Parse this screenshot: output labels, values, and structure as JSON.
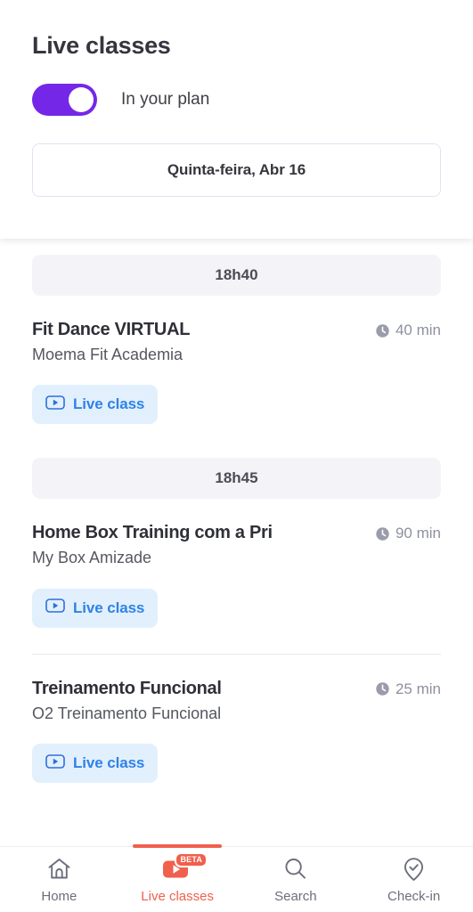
{
  "header": {
    "title": "Live classes",
    "toggle": {
      "label": "In your plan",
      "enabled": true,
      "color": "#7527e8"
    },
    "date_button": {
      "label": "Quinta-feira, Abr 16"
    }
  },
  "schedule": [
    {
      "time": "18h40",
      "classes": [
        {
          "title": "Fit Dance VIRTUAL",
          "studio": "Moema Fit Academia",
          "duration": "40 min",
          "badge": "Live class",
          "divider_after": false
        }
      ]
    },
    {
      "time": "18h45",
      "classes": [
        {
          "title": "Home Box Training com a Pri",
          "studio": "My Box Amizade",
          "duration": "90 min",
          "badge": "Live class",
          "divider_after": true
        },
        {
          "title": "Treinamento Funcional",
          "studio": "O2 Treinamento Funcional",
          "duration": "25 min",
          "badge": "Live class",
          "divider_after": false
        }
      ]
    }
  ],
  "bottom_nav": {
    "active_color": "#f0604d",
    "items": [
      {
        "label": "Home",
        "icon": "home-icon",
        "active": false,
        "badge": null
      },
      {
        "label": "Live classes",
        "icon": "play-video-icon",
        "active": true,
        "badge": "BETA"
      },
      {
        "label": "Search",
        "icon": "search-icon",
        "active": false,
        "badge": null
      },
      {
        "label": "Check-in",
        "icon": "map-pin-check-icon",
        "active": false,
        "badge": null
      }
    ]
  }
}
